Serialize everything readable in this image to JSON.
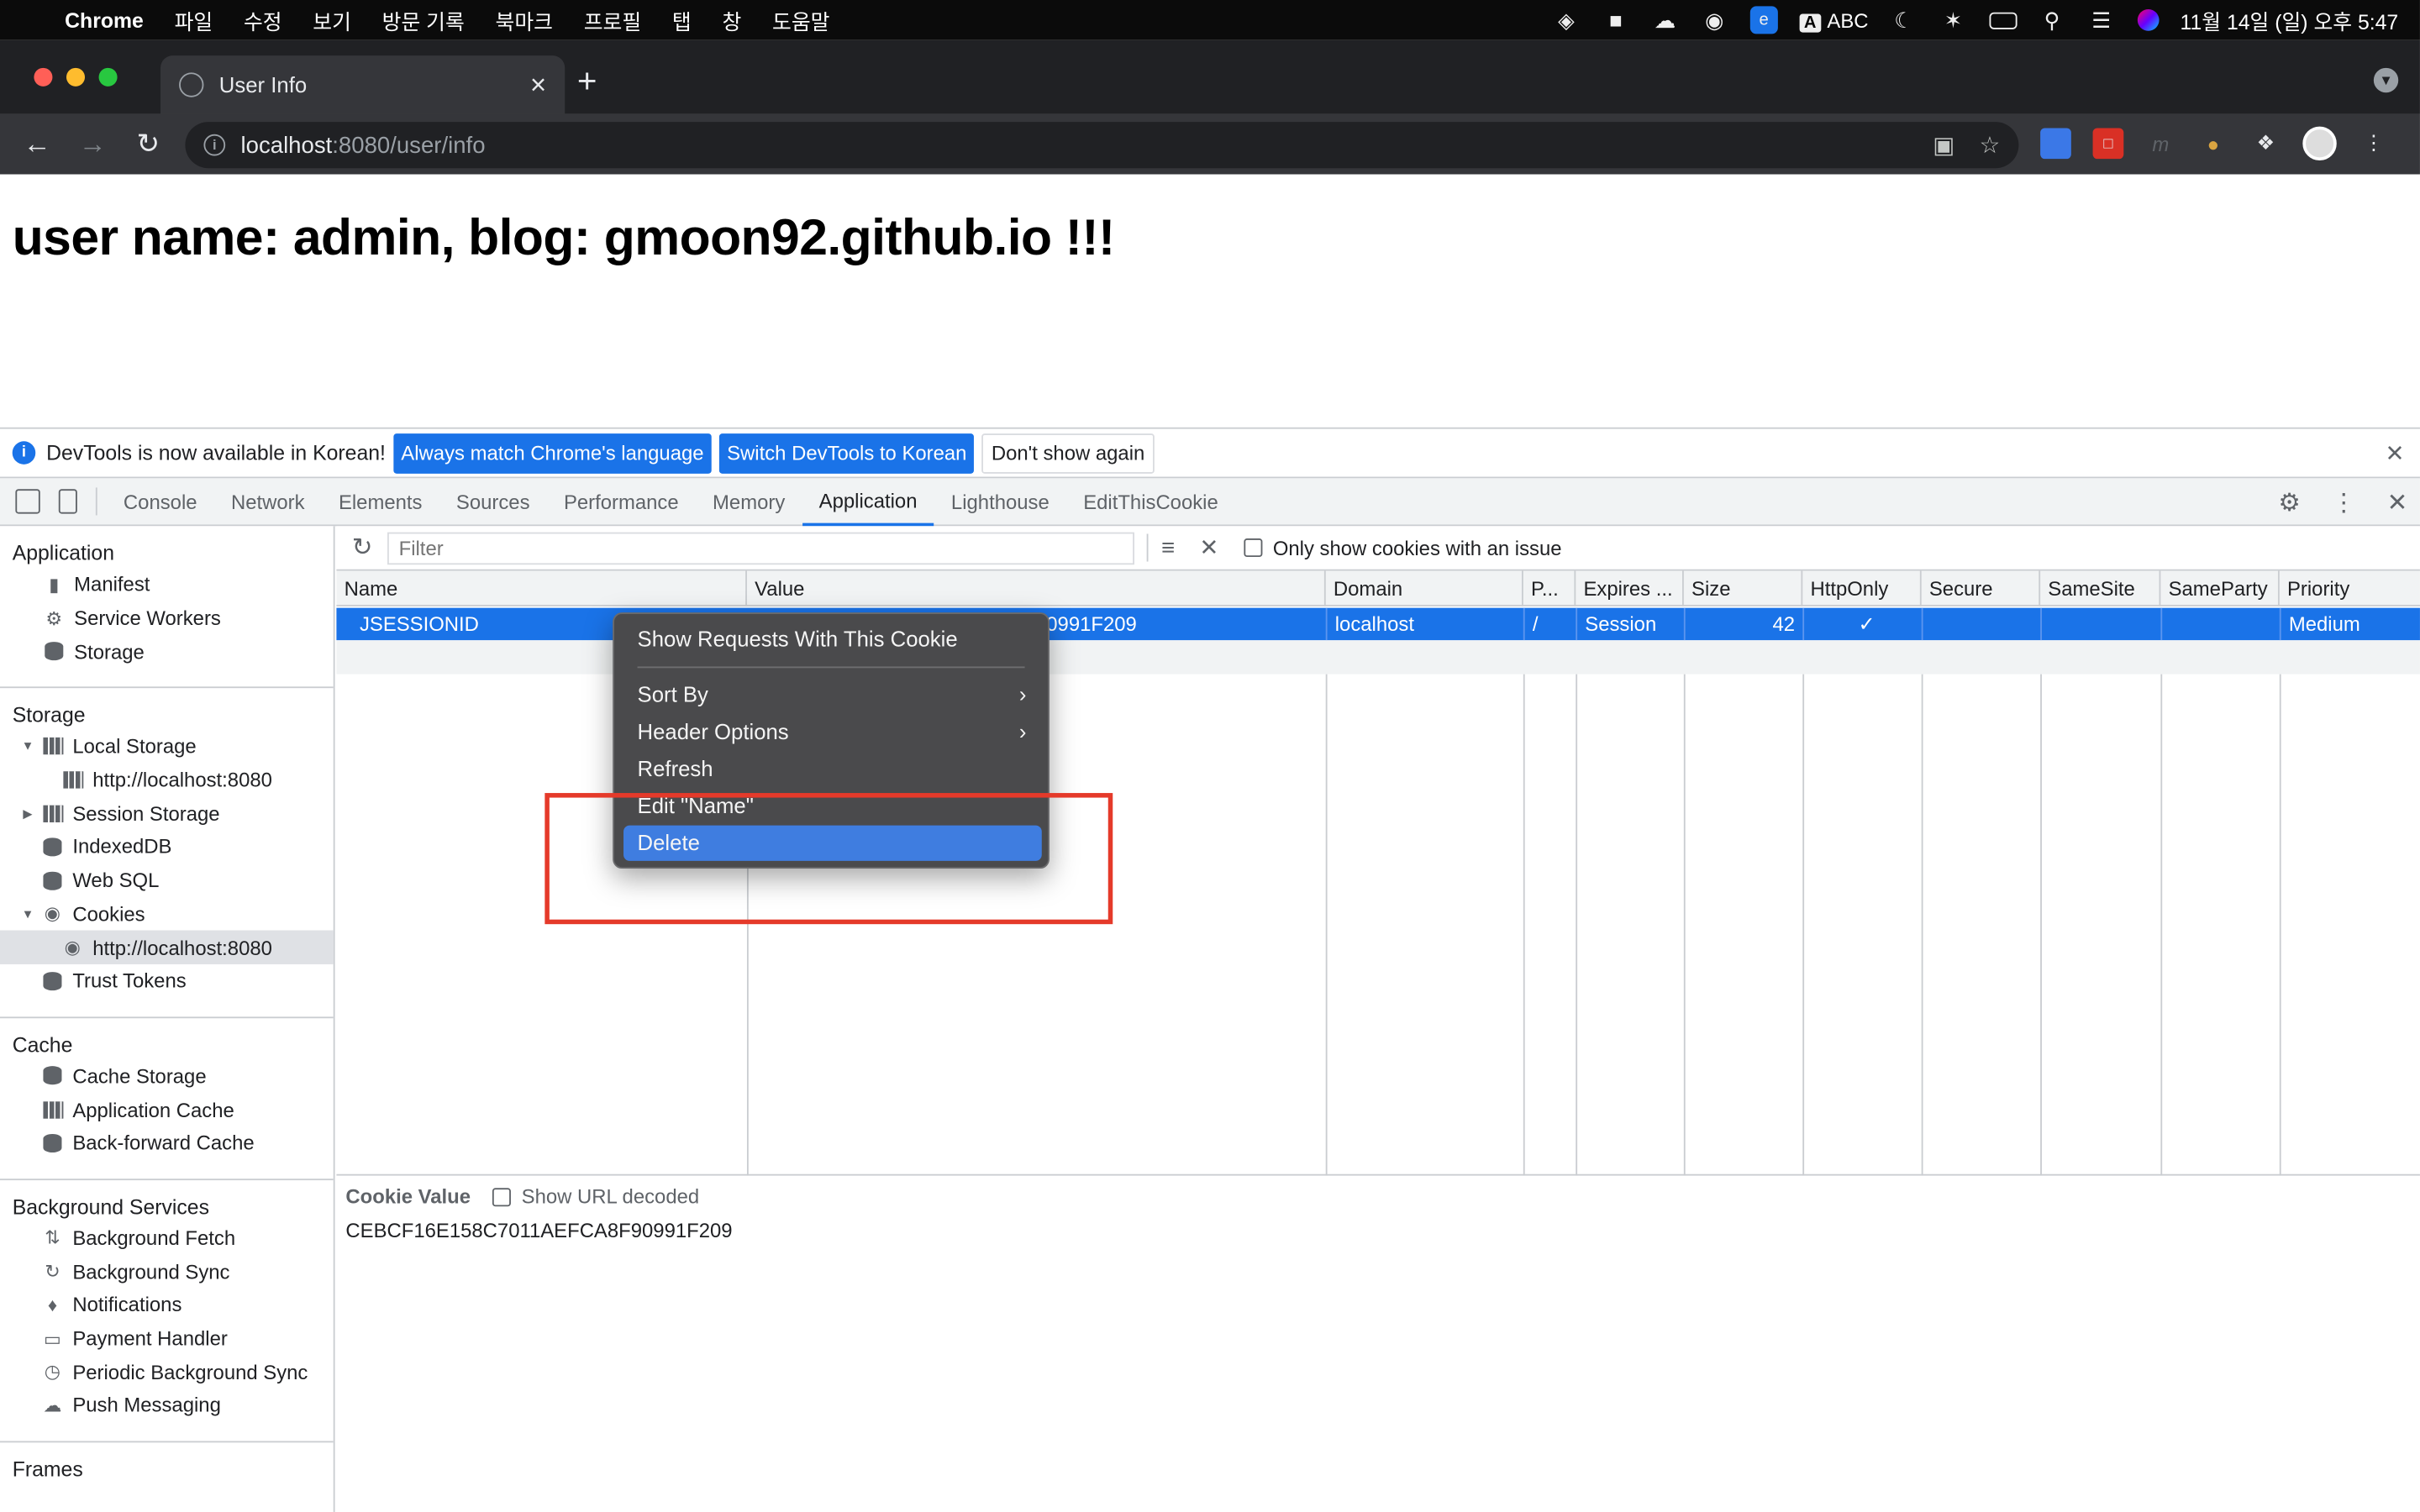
{
  "mac_menubar": {
    "app": "Chrome",
    "items": [
      "파일",
      "수정",
      "보기",
      "방문 기록",
      "북마크",
      "프로필",
      "탭",
      "창",
      "도움말"
    ],
    "input_source": "ABC",
    "clock": "11월 14일 (일) 오후 5:47"
  },
  "browser": {
    "tab_title": "User Info",
    "url_host": "localhost",
    "url_path": ":8080/user/info"
  },
  "page": {
    "heading": "user name: admin, blog: gmoon92.github.io !!!"
  },
  "devtools": {
    "infobar": {
      "message": "DevTools is now available in Korean!",
      "btn_match": "Always match Chrome's language",
      "btn_switch": "Switch DevTools to Korean",
      "btn_dismiss": "Don't show again"
    },
    "tabs": [
      "Console",
      "Network",
      "Elements",
      "Sources",
      "Performance",
      "Memory",
      "Application",
      "Lighthouse",
      "EditThisCookie"
    ],
    "active_tab": "Application",
    "sidebar": {
      "application": {
        "title": "Application",
        "items": [
          "Manifest",
          "Service Workers",
          "Storage"
        ]
      },
      "storage": {
        "title": "Storage",
        "local_storage": "Local Storage",
        "local_storage_origin": "http://localhost:8080",
        "session_storage": "Session Storage",
        "indexeddb": "IndexedDB",
        "websql": "Web SQL",
        "cookies": "Cookies",
        "cookies_origin": "http://localhost:8080",
        "trust_tokens": "Trust Tokens"
      },
      "cache": {
        "title": "Cache",
        "items": [
          "Cache Storage",
          "Application Cache",
          "Back-forward Cache"
        ]
      },
      "background": {
        "title": "Background Services",
        "items": [
          "Background Fetch",
          "Background Sync",
          "Notifications",
          "Payment Handler",
          "Periodic Background Sync",
          "Push Messaging"
        ]
      },
      "frames": {
        "title": "Frames"
      }
    },
    "cookies": {
      "filter_placeholder": "Filter",
      "only_issue_label": "Only show cookies with an issue",
      "columns": [
        "Name",
        "Value",
        "Domain",
        "P...",
        "Expires ...",
        "Size",
        "HttpOnly",
        "Secure",
        "SameSite",
        "SameParty",
        "Priority"
      ],
      "row": {
        "name": "JSESSIONID",
        "value_tail": "0991F209",
        "domain": "localhost",
        "path": "/",
        "expires": "Session",
        "size": "42",
        "httponly": "✓",
        "secure": "",
        "samesite": "",
        "sameparty": "",
        "priority": "Medium"
      },
      "value_panel_title": "Cookie Value",
      "show_url_decoded": "Show URL decoded",
      "cookie_value": "CEBCF16E158C7011AEFCA8F90991F209"
    },
    "context_menu": {
      "show_requests": "Show Requests With This Cookie",
      "sort_by": "Sort By",
      "header_options": "Header Options",
      "refresh": "Refresh",
      "edit_name": "Edit \"Name\"",
      "delete": "Delete"
    }
  },
  "colors": {
    "selection_blue": "#1a73e8",
    "menu_highlight": "#3f7de0",
    "annotation_red": "#e53a2a"
  }
}
